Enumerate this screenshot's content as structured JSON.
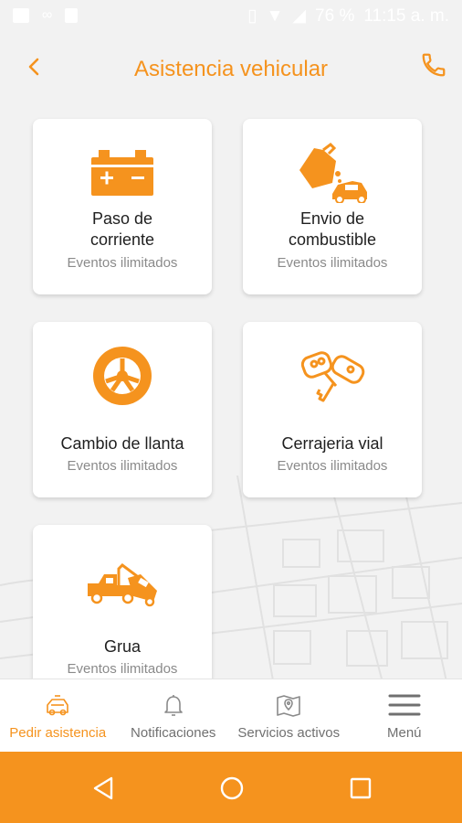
{
  "status_bar": {
    "battery": "76 %",
    "time": "11:15 a. m."
  },
  "header": {
    "title": "Asistencia vehicular"
  },
  "services": [
    {
      "name_line1": "Paso de",
      "name_line2": "corriente",
      "subtitle": "Eventos ilimitados",
      "icon": "battery-icon"
    },
    {
      "name_line1": "Envio de",
      "name_line2": "combustible",
      "subtitle": "Eventos ilimitados",
      "icon": "fuel-can-icon"
    },
    {
      "name": "Cambio de llanta",
      "subtitle": "Eventos ilimitados",
      "icon": "tire-icon"
    },
    {
      "name": "Cerrajeria vial",
      "subtitle": "Eventos ilimitados",
      "icon": "car-keys-icon"
    },
    {
      "name": "Grua",
      "subtitle": "Eventos ilimitados",
      "icon": "tow-truck-icon"
    }
  ],
  "bottom_nav": [
    {
      "label": "Pedir asistencia",
      "icon": "car-assist-icon",
      "active": true
    },
    {
      "label": "Notificaciones",
      "icon": "bell-icon",
      "active": false
    },
    {
      "label": "Servicios activos",
      "icon": "map-pin-icon",
      "active": false
    },
    {
      "label": "Menú",
      "icon": "hamburger-menu-icon",
      "active": false
    }
  ],
  "colors": {
    "accent": "#f5931e",
    "background": "#f2f2f2",
    "text": "#1f1f1f",
    "muted": "#8a8a8a"
  }
}
